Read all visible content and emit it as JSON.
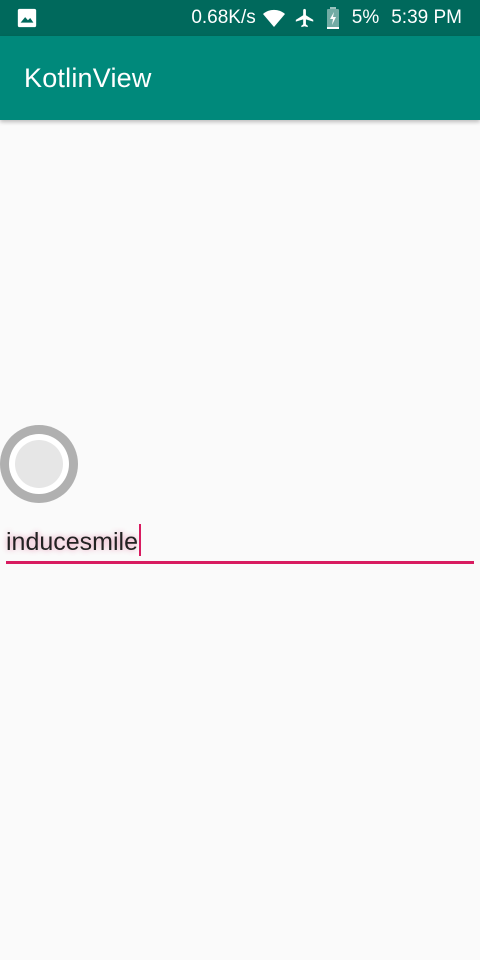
{
  "status_bar": {
    "network_speed": "0.68K/s",
    "battery_percent": "5%",
    "time": "5:39 PM",
    "icons": [
      "image-icon",
      "wifi-icon",
      "airplane-icon",
      "battery-charging-icon"
    ]
  },
  "app_bar": {
    "title": "KotlinView"
  },
  "form": {
    "radio_checked": false,
    "edit_value": "inducesmile"
  },
  "colors": {
    "status_bar": "#00695c",
    "app_bar": "#00897b",
    "accent": "#d81b60",
    "background": "#fafafa"
  }
}
